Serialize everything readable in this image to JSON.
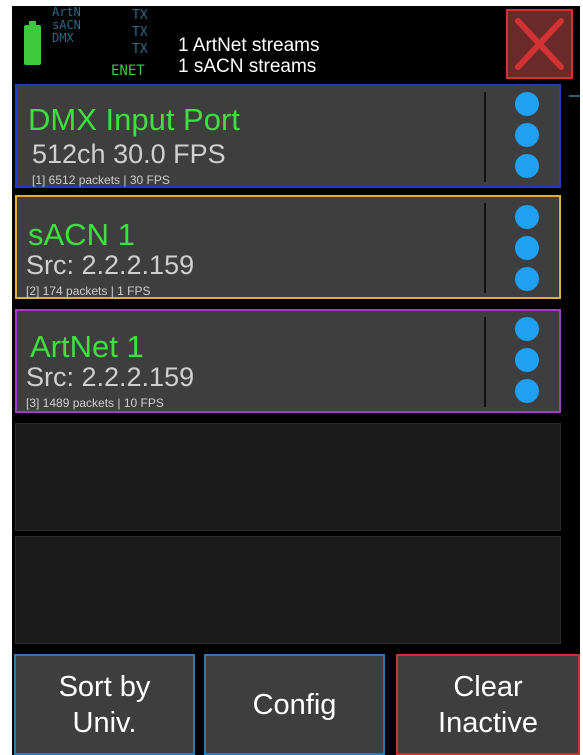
{
  "status": {
    "protocols": [
      "ArtN",
      "sACN",
      "DMX"
    ],
    "tx_labels": [
      "TX",
      "TX",
      "TX"
    ],
    "enet_label": "ENET",
    "streams_line1": "1 ArtNet streams",
    "streams_line2": "1 sACN streams"
  },
  "streams": [
    {
      "title": "DMX Input Port",
      "subtitle": "512ch 30.0 FPS",
      "info": "[1] 6512 packets | 30 FPS",
      "border_color": "#1e3cc8"
    },
    {
      "title": "sACN 1",
      "subtitle": "Src: 2.2.2.159",
      "info": "[2] 174 packets | 1 FPS",
      "border_color": "#e0b030"
    },
    {
      "title": "ArtNet 1",
      "subtitle": "Src: 2.2.2.159",
      "info": "[3] 1489 packets | 10 FPS",
      "border_color": "#a03cc8"
    }
  ],
  "buttons": {
    "sort_line1": "Sort by",
    "sort_line2": "Univ.",
    "config": "Config",
    "clear_line1": "Clear",
    "clear_line2": "Inactive"
  },
  "colors": {
    "title_green": "#3ee03e",
    "indicator_blue": "#1fa0f0",
    "close_red": "#d23232"
  },
  "icons": {
    "close": "close-icon",
    "battery": "battery-icon",
    "indicator": "status-dot"
  }
}
